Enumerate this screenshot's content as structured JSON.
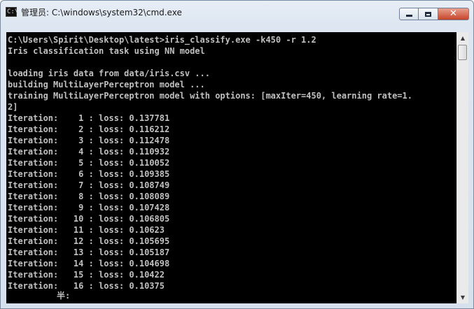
{
  "window": {
    "title": "管理员: C:\\windows\\system32\\cmd.exe",
    "app_icon": "cmd-icon",
    "app_icon_text": "C:\\",
    "controls": {
      "minimize_icon": "minimize-icon",
      "maximize_icon": "maximize-icon",
      "close_icon": "close-icon",
      "close_glyph": "✕"
    }
  },
  "colors": {
    "console_background": "#000000",
    "console_text": "#c0c0c0",
    "titlebar": "#dde6f1",
    "close_button": "#c7452a"
  },
  "console": {
    "lines": [
      "C:\\Users\\Spirit\\Desktop\\latest>iris_classify.exe -k450 -r 1.2",
      "Iris classification task using NN model",
      "",
      "loading iris data from data/iris.csv ...",
      "building MultiLayerPerceptron model ...",
      "training MultiLayerPerceptron model with options: [maxIter=450, learning rate=1.",
      "2]",
      "Iteration:    1 : loss: 0.137781",
      "Iteration:    2 : loss: 0.116212",
      "Iteration:    3 : loss: 0.112478",
      "Iteration:    4 : loss: 0.110932",
      "Iteration:    5 : loss: 0.110052",
      "Iteration:    6 : loss: 0.109385",
      "Iteration:    7 : loss: 0.108749",
      "Iteration:    8 : loss: 0.108089",
      "Iteration:    9 : loss: 0.107428",
      "Iteration:   10 : loss: 0.106805",
      "Iteration:   11 : loss: 0.10623",
      "Iteration:   12 : loss: 0.105695",
      "Iteration:   13 : loss: 0.105187",
      "Iteration:   14 : loss: 0.104698",
      "Iteration:   15 : loss: 0.10422",
      "Iteration:   16 : loss: 0.10375"
    ],
    "ime_indicator": "半:"
  },
  "scrollbar": {
    "up_icon": "scroll-up-arrow-icon",
    "down_icon": "scroll-down-arrow-icon",
    "up_glyph": "▲",
    "down_glyph": "▼"
  }
}
